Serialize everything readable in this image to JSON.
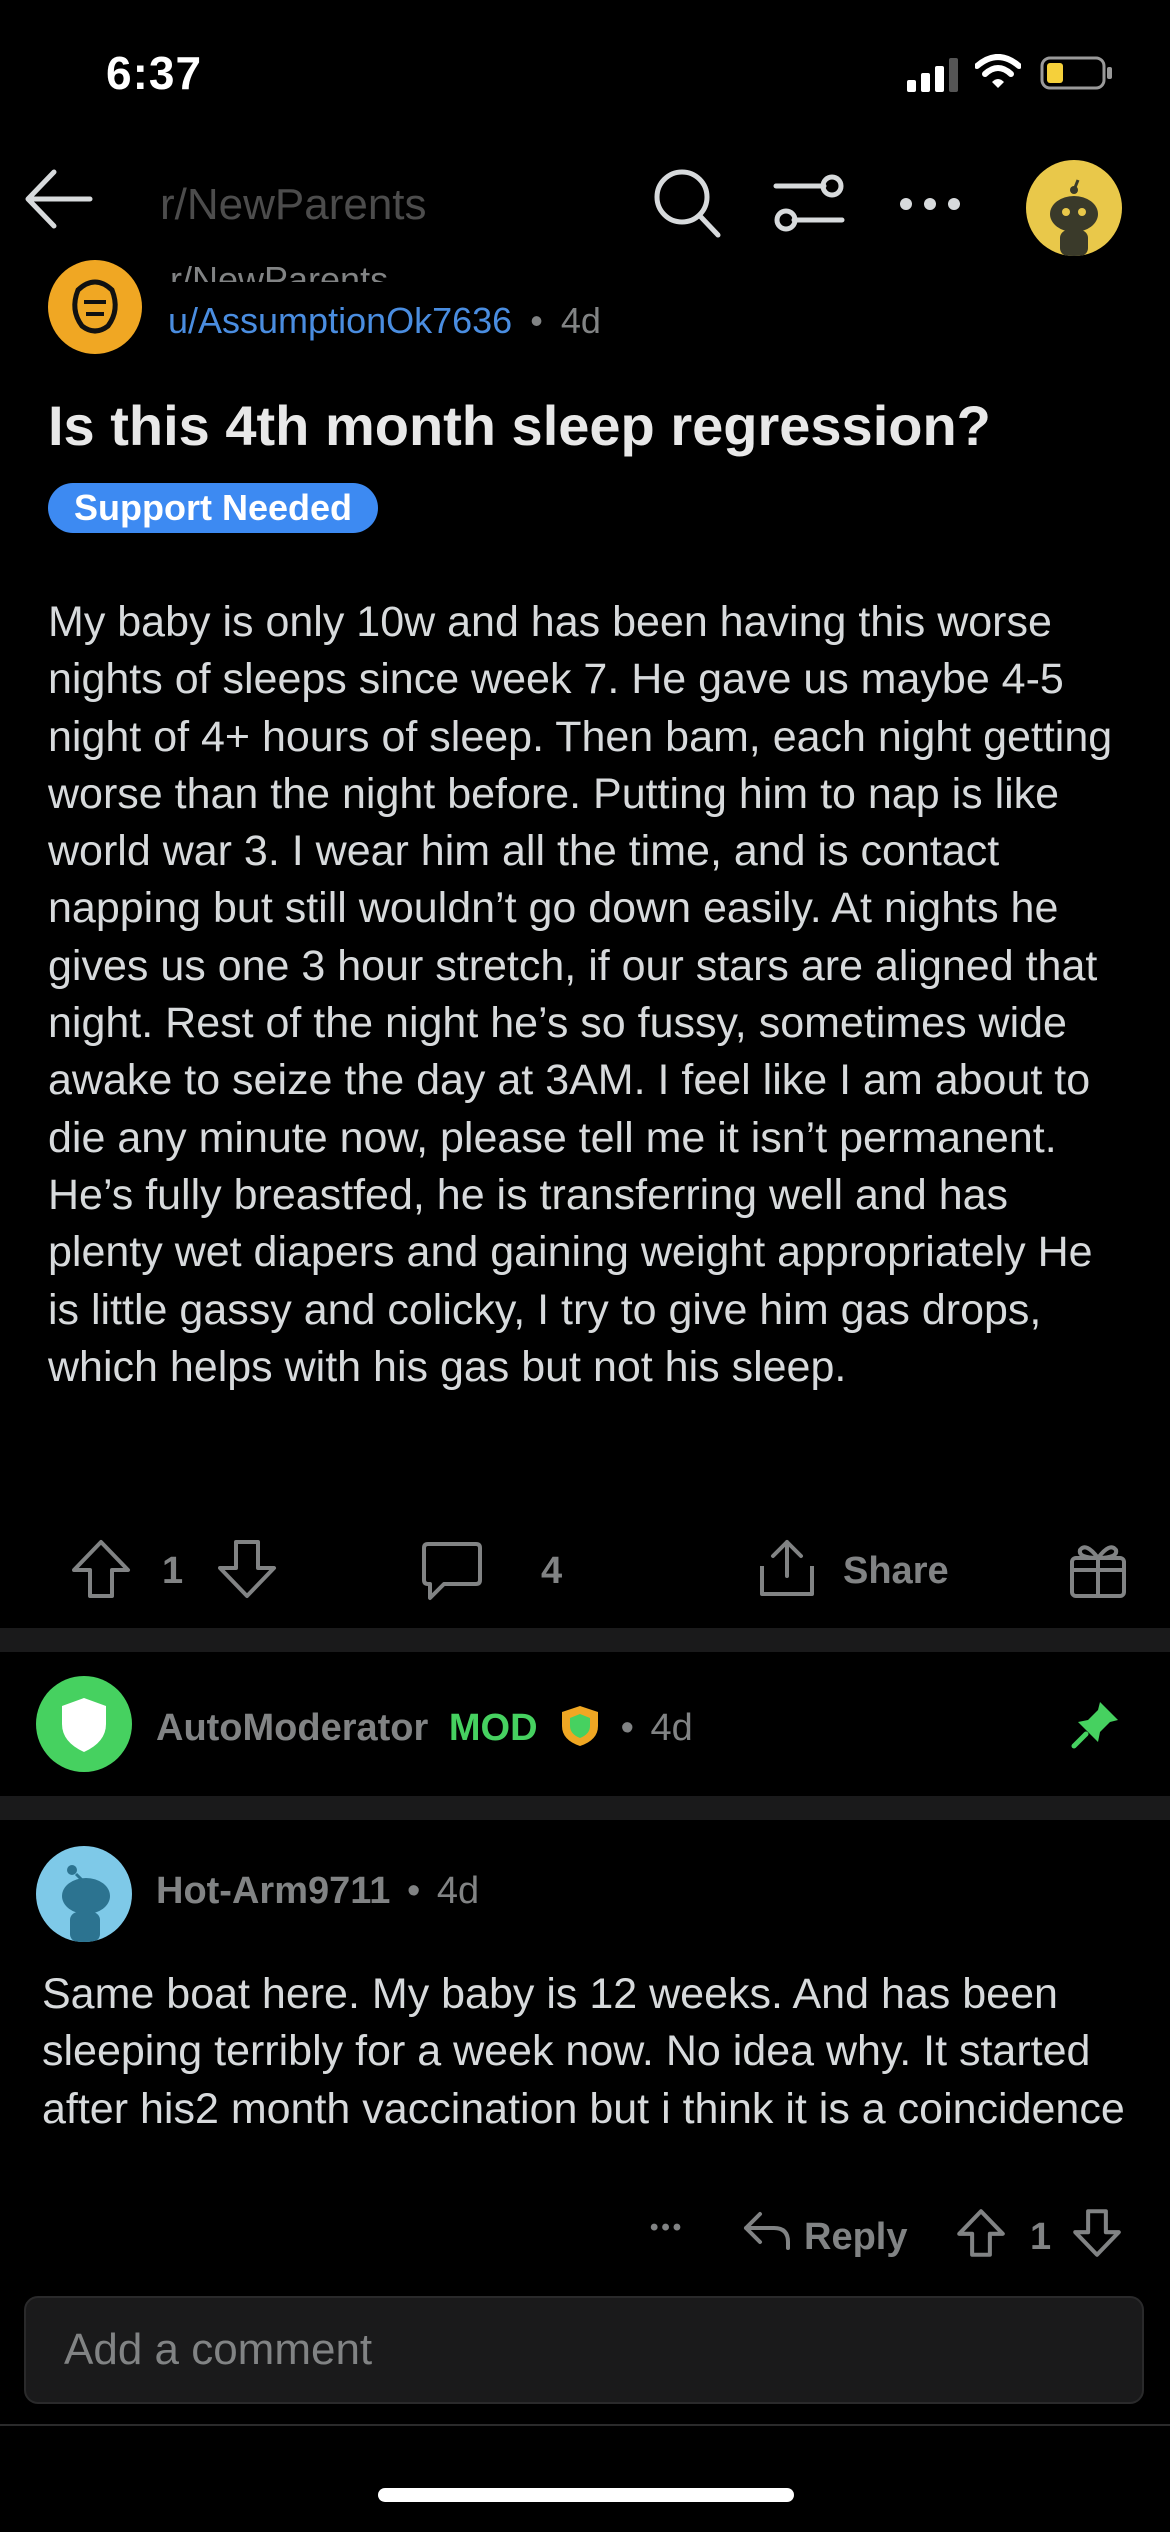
{
  "status_bar": {
    "time": "6:37"
  },
  "header": {
    "title": "r/NewParents"
  },
  "post": {
    "subreddit_cut": "r/NewParents",
    "author": "u/AssumptionOk7636",
    "separator": "•",
    "age": "4d",
    "title": "Is this 4th month sleep regression?",
    "flair": "Support Needed",
    "body": "My baby is only 10w and has been having this worse nights of sleeps since week 7. He gave us maybe 4-5 night of 4+ hours of sleep. Then bam, each night getting worse than the night before. Putting him to nap is like world war 3. I wear him all the time, and is contact napping but still wouldn’t go down easily. At nights he gives us one 3 hour stretch, if our stars are aligned that night. Rest of the night he’s so fussy, sometimes wide awake to seize the day at 3AM. I feel like I am about to die any minute now, please tell me it isn’t permanent. He’s fully breastfed, he is transferring well and has plenty wet diapers and gaining weight appropriately He is little gassy and colicky, I try to give him gas drops, which helps with his gas but not his sleep.",
    "score": "1",
    "comments": "4",
    "share_label": "Share"
  },
  "comments": [
    {
      "author": "AutoModerator",
      "tag": "MOD",
      "separator": "•",
      "age": "4d"
    },
    {
      "author": "Hot-Arm9711",
      "separator": "•",
      "age": "4d",
      "body": "Same boat here. My baby is 12 weeks. And has been sleeping terribly for a week now. No idea why. It started after his2 month vaccination but i think it is a coincidence",
      "more": "•••",
      "reply_label": "Reply",
      "score": "1"
    }
  ],
  "composer": {
    "placeholder": "Add a comment"
  },
  "colors": {
    "link": "#4a8de0",
    "flair": "#3d8af2",
    "mod": "#46d160",
    "background": "#000000"
  },
  "icons": [
    "back-arrow-icon",
    "search-icon",
    "sort-icon",
    "more-icon",
    "upvote-icon",
    "downvote-icon",
    "comment-icon",
    "share-icon",
    "award-icon",
    "pin-icon",
    "reply-icon"
  ]
}
